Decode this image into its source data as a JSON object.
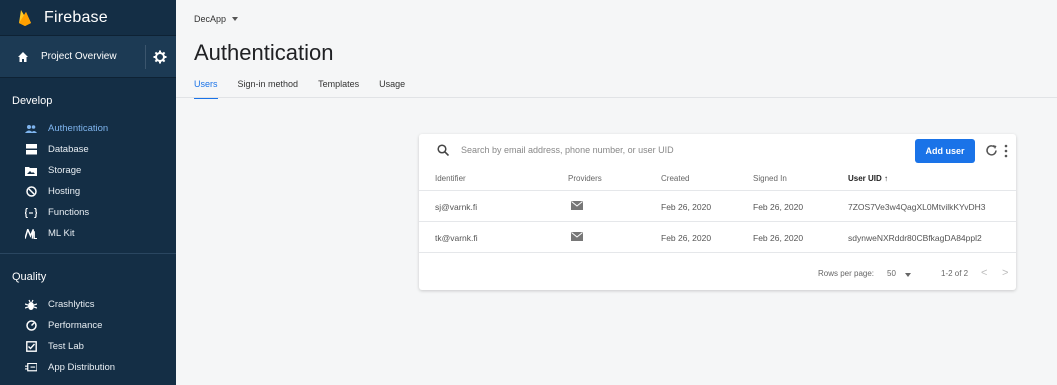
{
  "sidebar": {
    "brand": "Firebase",
    "project_overview": "Project Overview",
    "sections": [
      {
        "title": "Develop",
        "items": [
          {
            "label": "Authentication",
            "icon": "people-icon",
            "active": true
          },
          {
            "label": "Database",
            "icon": "database-icon"
          },
          {
            "label": "Storage",
            "icon": "storage-icon"
          },
          {
            "label": "Hosting",
            "icon": "hosting-icon"
          },
          {
            "label": "Functions",
            "icon": "functions-icon"
          },
          {
            "label": "ML Kit",
            "icon": "ml-kit-icon"
          }
        ]
      },
      {
        "title": "Quality",
        "items": [
          {
            "label": "Crashlytics",
            "icon": "crashlytics-icon"
          },
          {
            "label": "Performance",
            "icon": "performance-icon"
          },
          {
            "label": "Test Lab",
            "icon": "test-lab-icon"
          },
          {
            "label": "App Distribution",
            "icon": "app-distribution-icon"
          }
        ]
      }
    ]
  },
  "header": {
    "project": "DecApp",
    "title": "Authentication",
    "tabs": [
      {
        "label": "Users",
        "active": true
      },
      {
        "label": "Sign-in method"
      },
      {
        "label": "Templates"
      },
      {
        "label": "Usage"
      }
    ]
  },
  "users": {
    "search_placeholder": "Search by email address, phone number, or user UID",
    "add_user": "Add user",
    "columns": [
      "Identifier",
      "Providers",
      "Created",
      "Signed In",
      "User UID",
      "↑"
    ],
    "rows": [
      {
        "identifier": "sj@varnk.fi",
        "provider": "mail-icon",
        "created": "Feb 26, 2020",
        "signed_in": "Feb 26, 2020",
        "uid": "7ZOS7Ve3w4QagXL0MtvilkKYvDH3"
      },
      {
        "identifier": "tk@varnk.fi",
        "provider": "mail-icon",
        "created": "Feb 26, 2020",
        "signed_in": "Feb 26, 2020",
        "uid": "sdynweNXRddr80CBfkagDA84ppl2"
      }
    ],
    "footer": {
      "rows_per_page_label": "Rows per page:",
      "rows_per_page": "50",
      "range": "1-2 of 2",
      "prev": "<",
      "next": ">"
    }
  },
  "colors": {
    "sidebar_bg": "#142e45",
    "accent": "#1a73e8",
    "active_nav": "#7fb5ef"
  }
}
